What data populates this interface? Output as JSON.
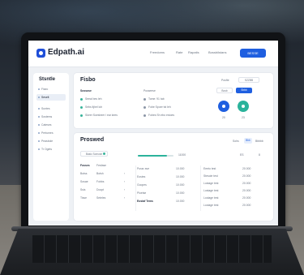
{
  "app": {
    "logo": "Edpath.ai",
    "nav": [
      "Freedoms",
      "Rate",
      "Rapatis",
      "Bossbilstans"
    ],
    "cta_label": "BESSE"
  },
  "sidebar": {
    "title": "Stsntle",
    "items": [
      "Fiseo",
      "Seselt",
      "Suntes",
      "Sostems",
      "Cateses",
      "Pertumes",
      "Peasbole",
      "Tr Ogets"
    ]
  },
  "top_card": {
    "title": "Fisbo",
    "badge_left": "Posfte",
    "badge_right": "SZZBB",
    "col1_header": "Sossose",
    "col1_rows": [
      "Seeal bes  leh",
      "Sebs  ltjhel  loh",
      "Skeer  Soesheer  l  ear kees"
    ],
    "col2_header": "Pusseese",
    "col2_rows": [
      "Tome: 91 tab",
      "Fobe  Spoer tst  leh",
      "Fobes  Sh ebo  estoes"
    ],
    "toggle_labels": [
      "Bosb",
      "Sbbb"
    ],
    "stat_labels": [
      "20",
      "23"
    ],
    "colors": {
      "blue": "#1f5fe0",
      "teal": "#2bb39b"
    }
  },
  "bottom_card": {
    "title": "Proswed",
    "filter_label": "Basic  Somuse",
    "progress_fraction": 0.82,
    "progress_value": "11000",
    "right_labels": [
      "Sohs",
      "Bbb",
      "Bbbbb"
    ],
    "top_right_values": [
      "ES",
      "8"
    ],
    "left_table": {
      "headers": [
        "Fosses",
        "Fesfase"
      ],
      "rows": [
        [
          "Botss",
          "Botsh"
        ],
        [
          "Sosae",
          "Fobbs"
        ],
        [
          "Ssis",
          "Doopt"
        ],
        [
          "Tisse",
          "Seteles"
        ]
      ]
    },
    "mid_table": {
      "rows": [
        [
          "Pussr ave",
          "10.000"
        ],
        [
          "Eostes",
          "10.000"
        ],
        [
          "Goopes",
          "10.000"
        ],
        [
          "Ploetse",
          "10.000"
        ],
        [
          "Eostaf Tems",
          "10.000"
        ]
      ]
    },
    "right_table": {
      "rows": [
        [
          "Eeeto test",
          "20.000"
        ],
        [
          "Stesole test",
          "20.000"
        ],
        [
          "Lostage test",
          "20.000"
        ],
        [
          "Lostage test",
          "20.000"
        ],
        [
          "Loolage test",
          "20.000"
        ],
        [
          "Loolage test",
          "20.000"
        ]
      ]
    }
  }
}
